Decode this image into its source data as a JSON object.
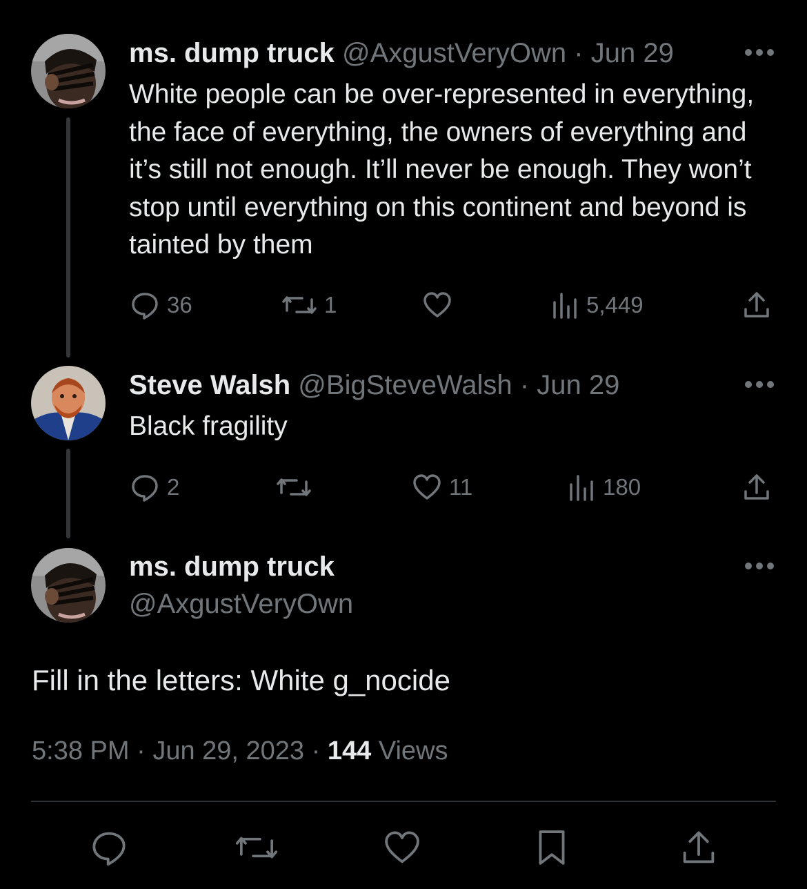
{
  "thread": [
    {
      "display_name": "ms. dump truck",
      "handle": "@AxgustVeryOwn",
      "separator": "·",
      "date": "Jun 29",
      "text": "White people can be over-represented in everything, the face of everything, the owners of everything and it’s still not enough. It’ll never be enough. They won’t stop until everything on this continent and beyond is tainted by them",
      "replies": "36",
      "reposts": "1",
      "likes": "",
      "views": "5,449",
      "avatar_icon": "user-avatar-photo"
    },
    {
      "display_name": "Steve Walsh",
      "handle": "@BigSteveWalsh",
      "separator": "·",
      "date": "Jun 29",
      "text": "Black fragility",
      "replies": "2",
      "reposts": "",
      "likes": "11",
      "views": "180",
      "avatar_icon": "user-avatar-photo"
    }
  ],
  "main_tweet": {
    "display_name": "ms. dump truck",
    "handle": "@AxgustVeryOwn",
    "text": "Fill in the letters: White g_nocide",
    "time": "5:38 PM",
    "separator": "·",
    "date": "Jun 29, 2023",
    "views_count": "144",
    "views_label": "Views"
  },
  "icons": {
    "more": "more-horizontal-icon",
    "reply": "reply-icon",
    "repost": "repost-icon",
    "like": "heart-icon",
    "views": "views-chart-icon",
    "share": "share-icon",
    "bookmark": "bookmark-icon"
  },
  "colors": {
    "background": "#000000",
    "text_primary": "#e7e9ea",
    "text_secondary": "#71767b",
    "divider": "#2f3336",
    "thread_line": "#333639"
  }
}
